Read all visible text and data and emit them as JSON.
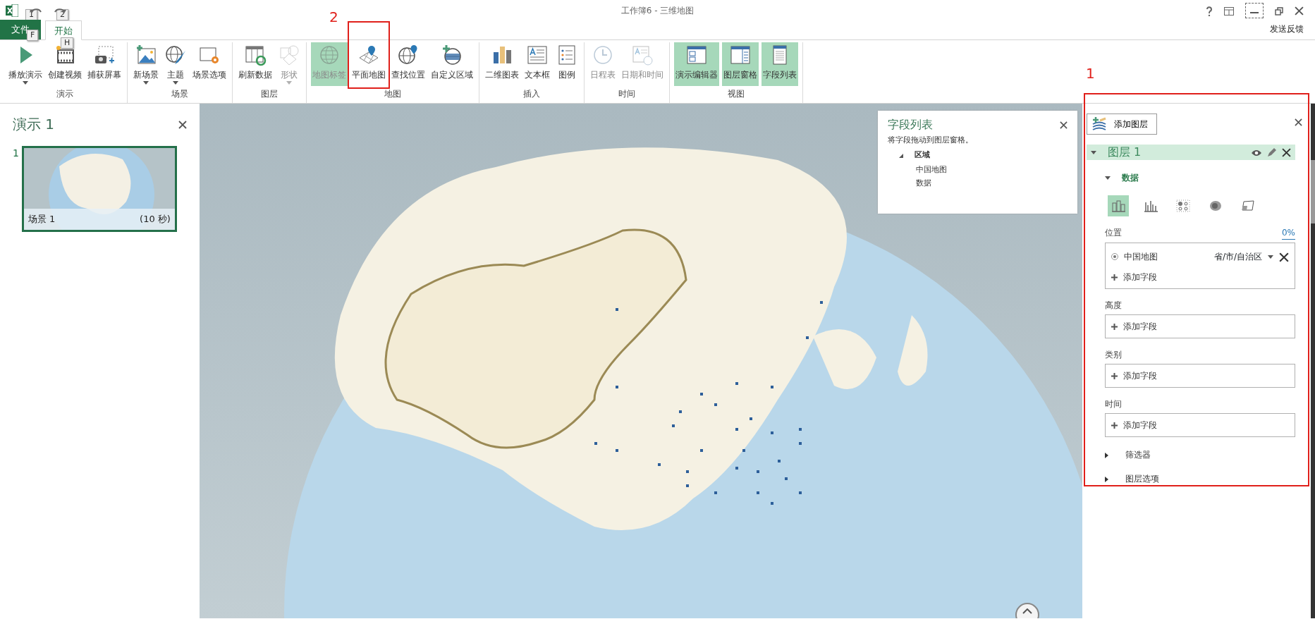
{
  "window": {
    "title": "工作簿6 - 三维地图",
    "quick_access_keytips": [
      "1",
      "2"
    ]
  },
  "ribbon_tabs": [
    {
      "label": "文件",
      "keytip": "F",
      "kind": "file",
      "selected": false
    },
    {
      "label": "开始",
      "keytip": "H",
      "kind": "tab",
      "selected": true
    }
  ],
  "feedback": "发送反馈",
  "ribbon_groups": [
    {
      "label": "演示",
      "buttons": [
        {
          "label": "播放演示",
          "dropdown": true,
          "disabled": false,
          "selected": false
        },
        {
          "label": "创建视频",
          "dropdown": false,
          "disabled": false,
          "selected": false
        },
        {
          "label": "捕获屏幕",
          "dropdown": false,
          "disabled": false,
          "selected": false
        }
      ]
    },
    {
      "label": "场景",
      "buttons": [
        {
          "label": "新场景",
          "dropdown": true,
          "disabled": false,
          "selected": false
        },
        {
          "label": "主题",
          "dropdown": true,
          "disabled": false,
          "selected": false
        },
        {
          "label": "场景选项",
          "dropdown": false,
          "disabled": false,
          "selected": false
        }
      ]
    },
    {
      "label": "图层",
      "buttons": [
        {
          "label": "刷新数据",
          "dropdown": false,
          "disabled": false,
          "selected": false
        },
        {
          "label": "形状",
          "dropdown": true,
          "disabled": true,
          "selected": false
        }
      ]
    },
    {
      "label": "地图",
      "buttons": [
        {
          "label": "地图标签",
          "dropdown": false,
          "disabled": true,
          "selected": true
        },
        {
          "label": "平面地图",
          "dropdown": false,
          "disabled": false,
          "selected": false
        },
        {
          "label": "查找位置",
          "dropdown": false,
          "disabled": false,
          "selected": false
        },
        {
          "label": "自定义区域",
          "dropdown": false,
          "disabled": false,
          "selected": false
        }
      ]
    },
    {
      "label": "插入",
      "buttons": [
        {
          "label": "二维图表",
          "dropdown": false,
          "disabled": false,
          "selected": false
        },
        {
          "label": "文本框",
          "dropdown": false,
          "disabled": false,
          "selected": false
        },
        {
          "label": "图例",
          "dropdown": false,
          "disabled": false,
          "selected": false
        }
      ]
    },
    {
      "label": "时间",
      "buttons": [
        {
          "label": "日程表",
          "dropdown": false,
          "disabled": true,
          "selected": false
        },
        {
          "label": "日期和时间",
          "dropdown": false,
          "disabled": true,
          "selected": false
        }
      ]
    },
    {
      "label": "视图",
      "buttons": [
        {
          "label": "演示编辑器",
          "dropdown": false,
          "disabled": false,
          "selected": true
        },
        {
          "label": "图层窗格",
          "dropdown": false,
          "disabled": false,
          "selected": true
        },
        {
          "label": "字段列表",
          "dropdown": false,
          "disabled": false,
          "selected": true
        }
      ]
    }
  ],
  "tour_panel": {
    "title": "演示 1",
    "scenes": [
      {
        "number": "1",
        "name": "场景 1",
        "duration": "(10 秒)",
        "selected": true
      }
    ]
  },
  "field_list": {
    "title": "字段列表",
    "hint": "将字段拖动到图层窗格。",
    "tables": [
      {
        "name": "区域",
        "expanded": true,
        "fields": [
          "中国地图",
          "数据"
        ]
      }
    ]
  },
  "layer_pane": {
    "add_layer": "添加图层",
    "layer": {
      "name": "图层 1",
      "expanded": true
    },
    "data_section": {
      "title": "数据",
      "expanded": true
    },
    "viz_types": [
      {
        "selected": true
      },
      {
        "selected": false
      },
      {
        "selected": false
      },
      {
        "selected": false
      },
      {
        "selected": false
      }
    ],
    "wells": [
      {
        "label": "位置",
        "progress": "0%",
        "fields": [
          {
            "name": "中国地图",
            "type": "省/市/自治区",
            "selected": true
          }
        ],
        "add": "添加字段"
      },
      {
        "label": "高度",
        "add": "添加字段"
      },
      {
        "label": "类别",
        "add": "添加字段"
      },
      {
        "label": "时间",
        "add": "添加字段"
      }
    ],
    "sections": [
      {
        "label": "筛选器",
        "expanded": false
      },
      {
        "label": "图层选项",
        "expanded": false
      }
    ]
  },
  "annotations": [
    {
      "label": "2"
    },
    {
      "label": "1"
    }
  ]
}
